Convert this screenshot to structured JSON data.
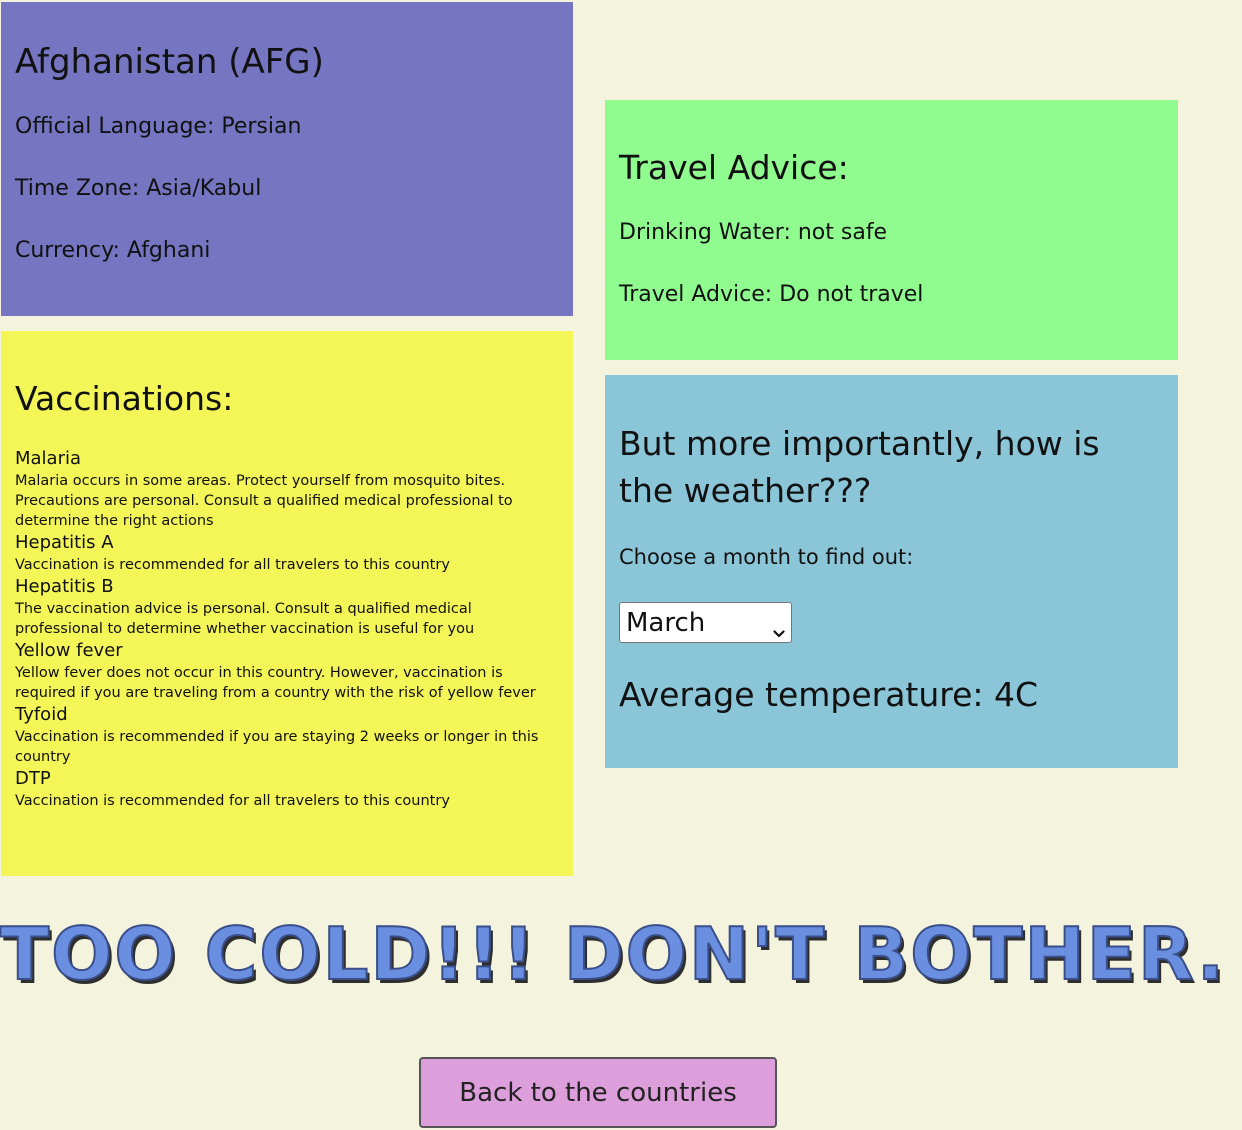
{
  "country": {
    "title": "Afghanistan (AFG)",
    "language": "Official Language: Persian",
    "timezone": "Time Zone: Asia/Kabul",
    "currency": "Currency: Afghani"
  },
  "vaccinations": {
    "heading": "Vaccinations:",
    "items": [
      {
        "name": "Malaria",
        "description": "Malaria occurs in some areas. Protect yourself from mosquito bites. Precautions are personal. Consult a qualified medical professional to determine the right actions"
      },
      {
        "name": "Hepatitis A",
        "description": "Vaccination is recommended for all travelers to this country"
      },
      {
        "name": "Hepatitis B",
        "description": "The vaccination advice is personal. Consult a qualified medical professional to determine whether vaccination is useful for you"
      },
      {
        "name": "Yellow fever",
        "description": "Yellow fever does not occur in this country. However, vaccination is required if you are traveling from a country with the risk of yellow fever"
      },
      {
        "name": "Tyfoid",
        "description": "Vaccination is recommended if you are staying 2 weeks or longer in this country"
      },
      {
        "name": "DTP",
        "description": "Vaccination is recommended for all travelers to this country"
      }
    ]
  },
  "advice": {
    "heading": "Travel Advice:",
    "water": "Drinking Water: not safe",
    "travel": "Travel Advice: Do not travel"
  },
  "weather": {
    "heading": "But more importantly, how is the weather???",
    "prompt": "Choose a month to find out:",
    "selected_month": "March",
    "temperature": "Average temperature: 4C"
  },
  "verdict": "TOO COLD!!! DON'T BOTHER.",
  "back_button": "Back to the countries",
  "colors": {
    "background": "#f4f3dd",
    "country_panel": "#7575c2",
    "vaccination_panel": "#f3f656",
    "advice_panel": "#90fb8f",
    "weather_panel": "#8bc6d8",
    "verdict_text": "#6b8fe0",
    "back_button": "#dd9fdb"
  },
  "icons": {
    "select_arrow": "chevron-down-icon"
  }
}
